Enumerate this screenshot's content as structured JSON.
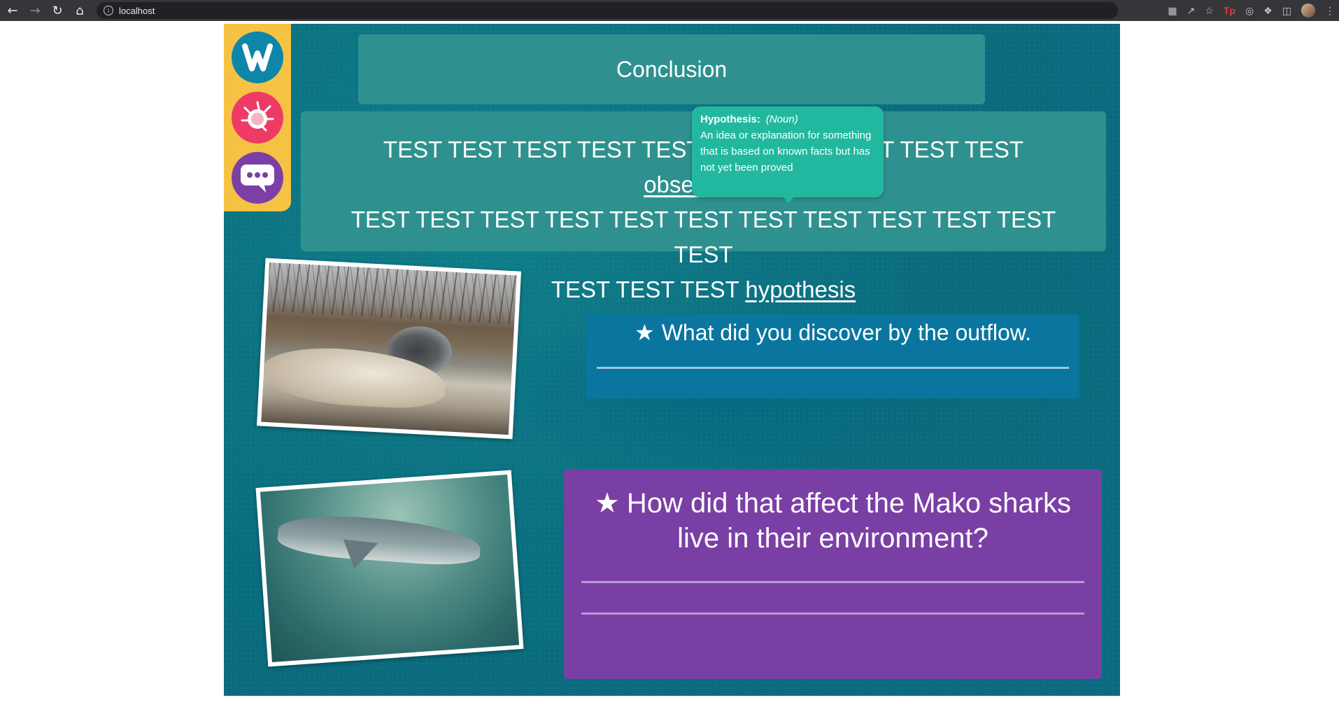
{
  "browser": {
    "url": "localhost",
    "back_icon": "back-arrow-icon",
    "forward_icon": "forward-arrow-icon",
    "reload_icon": "reload-icon",
    "home_icon": "home-icon",
    "extension_label_tp": "Tp"
  },
  "rail": {
    "items": [
      {
        "name": "logo-w-icon",
        "glyph": "W"
      },
      {
        "name": "splat-icon",
        "glyph": ""
      },
      {
        "name": "chat-bubble-icon",
        "glyph": "•••"
      }
    ],
    "colors": {
      "rail": "#f6c244",
      "logo": "#0e86a8",
      "splat": "#ee3b66",
      "chat": "#7b3fa6"
    }
  },
  "page": {
    "title": "Conclusion",
    "passage": {
      "line1_text": "TEST TEST TEST TEST TEST TEST TEST TEST TEST TEST ",
      "line1_vocab": "observation",
      "line2_text": "TEST TEST TEST TEST TEST TEST TEST TEST TEST TEST TEST TEST",
      "line3_text": "TEST TEST TEST ",
      "line3_vocab": "hypothesis"
    },
    "tooltip": {
      "term": "Hypothesis:",
      "part_of_speech": "(Noun)",
      "definition": "An idea or explanation for something that is based on known facts but has not yet been proved"
    },
    "photos": [
      {
        "name": "outflow-photo",
        "alt": "Water pouring from a culvert pipe"
      },
      {
        "name": "shark-photo",
        "alt": "Mako shark underwater"
      }
    ],
    "questions": [
      {
        "star": "★",
        "text": "What did you discover by the outflow."
      },
      {
        "star": "★",
        "text": "How did that affect the Mako sharks live in their environment?"
      }
    ]
  },
  "colors": {
    "stage": "#0a6b7c",
    "title_box": "#2e918f",
    "tooltip": "#22b8a0",
    "question1": "#0a76a0",
    "question2": "#7a3fa4"
  }
}
